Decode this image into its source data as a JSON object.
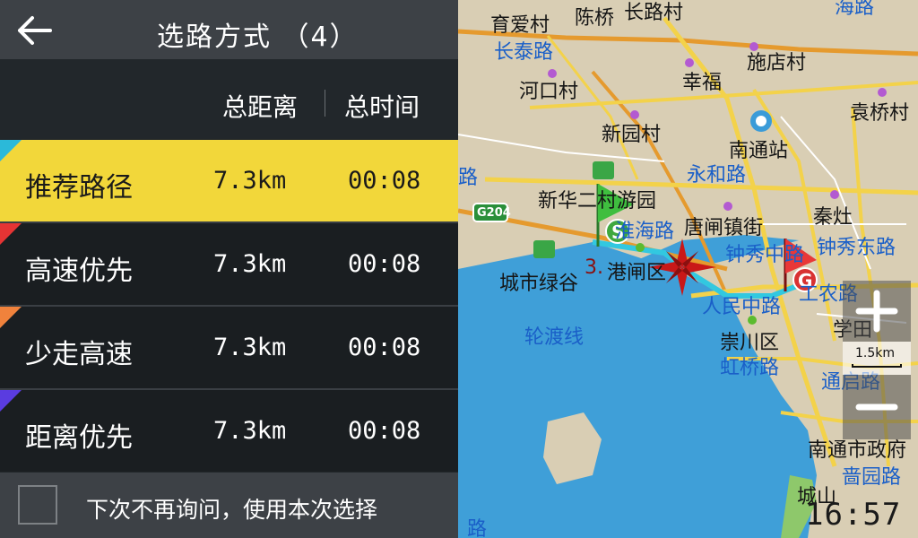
{
  "header": {
    "title": "选路方式  （4）"
  },
  "columns": {
    "distance": "总距离",
    "time": "总时间"
  },
  "routes": [
    {
      "name": "推荐路径",
      "distance": "7.3km",
      "time": "00:08",
      "selected": true,
      "color": "#2bb9d9"
    },
    {
      "name": "高速优先",
      "distance": "7.3km",
      "time": "00:08",
      "selected": false,
      "color": "#e53434"
    },
    {
      "name": "少走高速",
      "distance": "7.3km",
      "time": "00:08",
      "selected": false,
      "color": "#f0823c"
    },
    {
      "name": "距离优先",
      "distance": "7.3km",
      "time": "00:08",
      "selected": false,
      "color": "#5a3ce0"
    }
  ],
  "footer": {
    "checkbox_label": "下次不再询问，使用本次选择",
    "checked": false
  },
  "map": {
    "labels": {
      "l1": "育爱村",
      "l2": "陈桥",
      "l3": "长路村",
      "l4": "海路",
      "l5": "长泰路",
      "l6": "施店村",
      "l7": "幸福",
      "l8": "河口村",
      "l9": "袁桥村",
      "l10": "新园村",
      "l11": "南通站",
      "l12": "永和路",
      "l13": "路",
      "l14": "新华二村游园",
      "l15": "G204",
      "l16": "淮海路",
      "l17": "唐闸镇街",
      "l18": "秦灶",
      "l19": "钟秀中路",
      "l20": "钟秀东路",
      "l21": "城市绿谷",
      "l22": "3.",
      "l23": "港闸区",
      "l24": "工农路",
      "l25": "人民中路",
      "l26": "学田",
      "l27": "轮渡线",
      "l28": "崇川区",
      "l29": "虹桥路",
      "l30": "通启路",
      "l31": "南通市政府",
      "l32": "啬园路",
      "l33": "城山",
      "l34": "路"
    },
    "start_marker": "S",
    "end_marker": "G",
    "scale": "1.5km",
    "clock": "16:57"
  },
  "icons": {
    "back": "back-arrow-icon",
    "zoom_in": "plus-icon",
    "zoom_out": "minus-icon",
    "compass": "compass-star-icon"
  }
}
